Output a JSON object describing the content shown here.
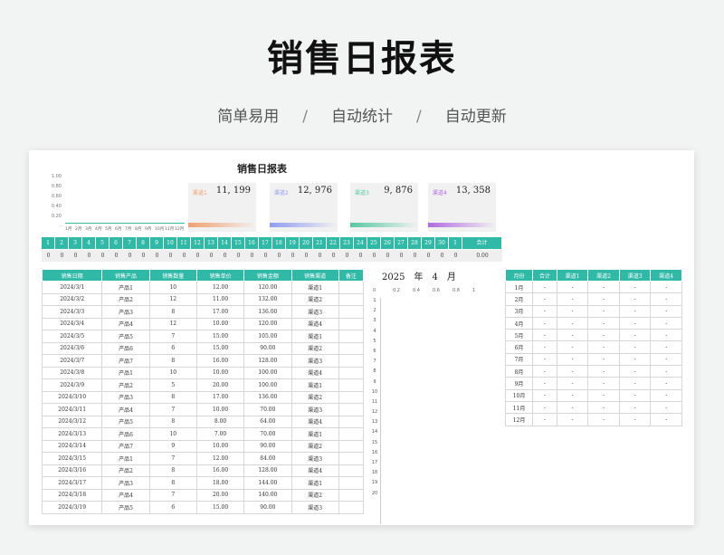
{
  "hero": {
    "title": "销售日报表",
    "sub1": "简单易用",
    "sub2": "自动统计",
    "sub3": "自动更新",
    "sep": "/"
  },
  "sheet": {
    "title": "销售日报表",
    "mini_chart": {
      "y_ticks": [
        "1.00",
        "0.80",
        "0.60",
        "0.40",
        "0.20",
        "-"
      ],
      "x_labels": [
        "1月",
        "2月",
        "3月",
        "4月",
        "5月",
        "6月",
        "7月",
        "8月",
        "9月",
        "10月",
        "11月",
        "12月"
      ]
    },
    "kpis": [
      {
        "label": "渠道1",
        "value": "11, 199",
        "color": "#f0a070"
      },
      {
        "label": "渠道2",
        "value": "12, 976",
        "color": "#8f9cf0"
      },
      {
        "label": "渠道3",
        "value": "9, 876",
        "color": "#56c8a0"
      },
      {
        "label": "渠道4",
        "value": "13, 358",
        "color": "#b06ae0"
      }
    ],
    "days": [
      "1",
      "2",
      "3",
      "4",
      "5",
      "6",
      "7",
      "8",
      "9",
      "10",
      "11",
      "12",
      "13",
      "14",
      "15",
      "16",
      "17",
      "18",
      "19",
      "20",
      "21",
      "22",
      "23",
      "24",
      "25",
      "26",
      "27",
      "28",
      "29",
      "30",
      "1"
    ],
    "days_total_label": "合计",
    "day_values": [
      "0",
      "0",
      "0",
      "0",
      "0",
      "0",
      "0",
      "0",
      "0",
      "0",
      "0",
      "0",
      "0",
      "0",
      "0",
      "0",
      "0",
      "0",
      "0",
      "0",
      "0",
      "0",
      "0",
      "0",
      "0",
      "0",
      "0",
      "0",
      "0",
      "0",
      "0"
    ],
    "day_total_value": "0.00",
    "main_headers": [
      "销售日期",
      "销售产品",
      "销售数量",
      "销售单价",
      "销售金额",
      "销售渠道",
      "备注"
    ],
    "rows": [
      [
        "2024/3/1",
        "产品1",
        "10",
        "12.00",
        "120.00",
        "渠道1",
        ""
      ],
      [
        "2024/3/2",
        "产品2",
        "12",
        "11.00",
        "132.00",
        "渠道2",
        ""
      ],
      [
        "2024/3/3",
        "产品3",
        "8",
        "17.00",
        "136.00",
        "渠道3",
        ""
      ],
      [
        "2024/3/4",
        "产品4",
        "12",
        "10.00",
        "120.00",
        "渠道4",
        ""
      ],
      [
        "2024/3/5",
        "产品5",
        "7",
        "15.00",
        "105.00",
        "渠道1",
        ""
      ],
      [
        "2024/3/6",
        "产品6",
        "6",
        "15.00",
        "90.00",
        "渠道2",
        ""
      ],
      [
        "2024/3/7",
        "产品7",
        "8",
        "16.00",
        "128.00",
        "渠道3",
        ""
      ],
      [
        "2024/3/8",
        "产品1",
        "10",
        "10.00",
        "100.00",
        "渠道4",
        ""
      ],
      [
        "2024/3/9",
        "产品2",
        "5",
        "20.00",
        "100.00",
        "渠道1",
        ""
      ],
      [
        "2024/3/10",
        "产品3",
        "8",
        "17.00",
        "136.00",
        "渠道2",
        ""
      ],
      [
        "2024/3/11",
        "产品4",
        "7",
        "10.00",
        "70.00",
        "渠道3",
        ""
      ],
      [
        "2024/3/12",
        "产品5",
        "8",
        "8.00",
        "64.00",
        "渠道4",
        ""
      ],
      [
        "2024/3/13",
        "产品6",
        "10",
        "7.00",
        "70.00",
        "渠道1",
        ""
      ],
      [
        "2024/3/14",
        "产品7",
        "9",
        "10.00",
        "90.00",
        "渠道2",
        ""
      ],
      [
        "2024/3/15",
        "产品1",
        "7",
        "12.00",
        "84.00",
        "渠道3",
        ""
      ],
      [
        "2024/3/16",
        "产品2",
        "8",
        "16.00",
        "128.00",
        "渠道4",
        ""
      ],
      [
        "2024/3/17",
        "产品3",
        "8",
        "18.00",
        "144.00",
        "渠道1",
        ""
      ],
      [
        "2024/3/18",
        "产品4",
        "7",
        "20.00",
        "140.00",
        "渠道2",
        ""
      ],
      [
        "2024/3/19",
        "产品5",
        "6",
        "15.00",
        "90.00",
        "渠道3",
        ""
      ]
    ],
    "year": "2025",
    "year_unit": "年",
    "month": "4",
    "month_unit": "月",
    "hbar_axis": [
      "0",
      "0.2",
      "0.4",
      "0.6",
      "0.8",
      "1"
    ],
    "hbar_rows": [
      "1",
      "2",
      "3",
      "4",
      "5",
      "6",
      "7",
      "8",
      "9",
      "10",
      "11",
      "12",
      "13",
      "14",
      "15",
      "16",
      "17",
      "18",
      "19",
      "20"
    ],
    "sum_headers": [
      "月份",
      "合计",
      "渠道1",
      "渠道2",
      "渠道3",
      "渠道4"
    ],
    "sum_rows": [
      [
        "1月",
        "-",
        "-",
        "-",
        "-",
        "-"
      ],
      [
        "2月",
        "-",
        "-",
        "-",
        "-",
        "-"
      ],
      [
        "3月",
        "-",
        "-",
        "-",
        "-",
        "-"
      ],
      [
        "4月",
        "-",
        "-",
        "-",
        "-",
        "-"
      ],
      [
        "5月",
        "-",
        "-",
        "-",
        "-",
        "-"
      ],
      [
        "6月",
        "-",
        "-",
        "-",
        "-",
        "-"
      ],
      [
        "7月",
        "-",
        "-",
        "-",
        "-",
        "-"
      ],
      [
        "8月",
        "-",
        "-",
        "-",
        "-",
        "-"
      ],
      [
        "9月",
        "-",
        "-",
        "-",
        "-",
        "-"
      ],
      [
        "10月",
        "-",
        "-",
        "-",
        "-",
        "-"
      ],
      [
        "11月",
        "-",
        "-",
        "-",
        "-",
        "-"
      ],
      [
        "12月",
        "-",
        "-",
        "-",
        "-",
        "-"
      ]
    ]
  }
}
